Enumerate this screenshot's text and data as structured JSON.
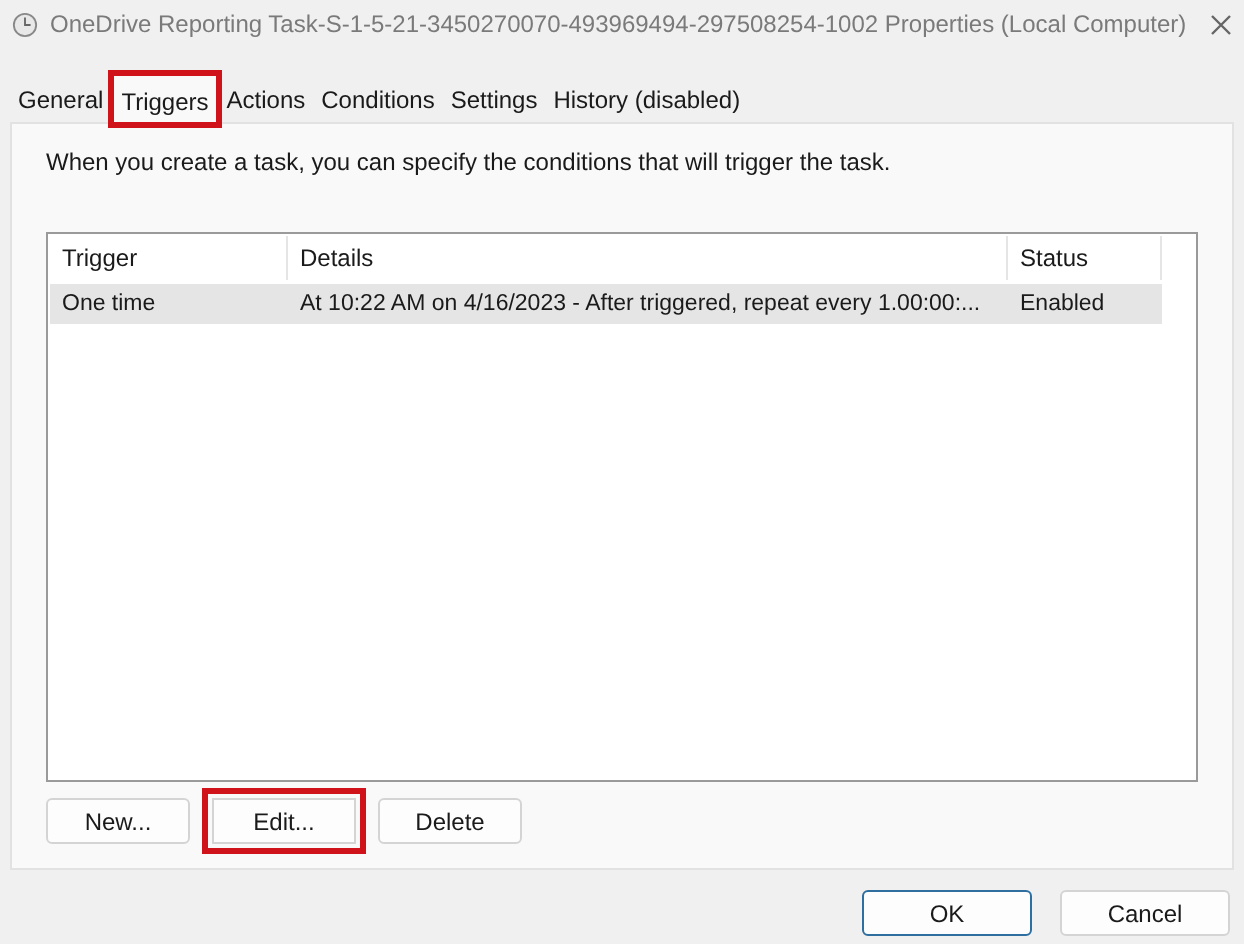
{
  "window": {
    "title": "OneDrive Reporting Task-S-1-5-21-3450270070-493969494-297508254-1002 Properties (Local Computer)"
  },
  "tabs": [
    {
      "label": "General",
      "selected": false,
      "highlighted": false
    },
    {
      "label": "Triggers",
      "selected": true,
      "highlighted": true
    },
    {
      "label": "Actions",
      "selected": false,
      "highlighted": false
    },
    {
      "label": "Conditions",
      "selected": false,
      "highlighted": false
    },
    {
      "label": "Settings",
      "selected": false,
      "highlighted": false
    },
    {
      "label": "History (disabled)",
      "selected": false,
      "highlighted": false
    }
  ],
  "description": "When you create a task, you can specify the conditions that will trigger the task.",
  "table": {
    "columns": [
      "Trigger",
      "Details",
      "Status"
    ],
    "rows": [
      {
        "cells": [
          "One time",
          "At 10:22 AM on 4/16/2023 - After triggered, repeat every 1.00:00:...",
          "Enabled"
        ],
        "selected": true
      }
    ]
  },
  "list_buttons": [
    {
      "label": "New...",
      "highlighted": false
    },
    {
      "label": "Edit...",
      "highlighted": true
    },
    {
      "label": "Delete",
      "highlighted": false
    }
  ],
  "dialog_buttons": [
    {
      "label": "OK",
      "default": true
    },
    {
      "label": "Cancel",
      "default": false
    }
  ]
}
